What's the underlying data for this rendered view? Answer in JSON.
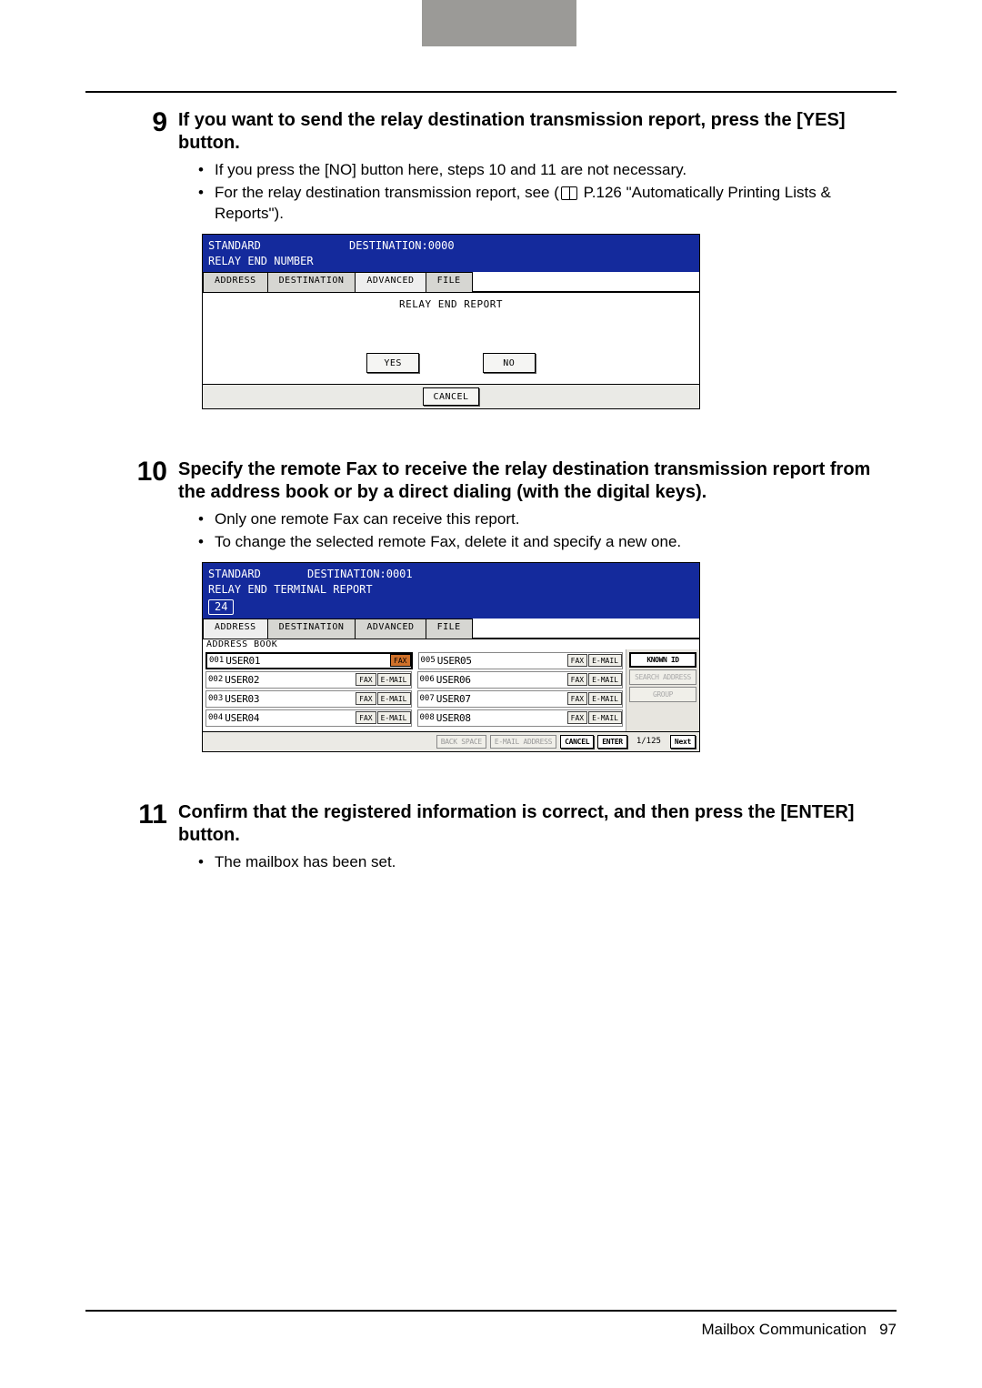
{
  "step9": {
    "num": "9",
    "title": "If you want to send the relay destination transmission report, press the [YES] button.",
    "bullets": [
      "If you press the [NO] button here, steps 10 and 11 are not necessary.",
      "For the relay destination transmission report, see (📖 P.126 \"Automatically Printing Lists & Reports\")."
    ],
    "mock": {
      "mode": "STANDARD",
      "dest": "DESTINATION:0000",
      "sub": "RELAY END NUMBER",
      "tabs": [
        "ADDRESS",
        "DESTINATION",
        "ADVANCED",
        "FILE"
      ],
      "label": "RELAY END REPORT",
      "yes": "YES",
      "no": "NO",
      "cancel": "CANCEL"
    }
  },
  "step10": {
    "num": "10",
    "title": "Specify the remote Fax to receive the relay destination transmission report from the address book or by a direct dialing (with the digital keys).",
    "bullets": [
      "Only one remote Fax can receive this report.",
      "To change the selected remote Fax, delete it and specify a new one."
    ],
    "mock": {
      "mode": "STANDARD",
      "dest": "DESTINATION:0001",
      "sub": "RELAY END TERMINAL REPORT",
      "numBox": "24",
      "tabs": [
        "ADDRESS",
        "DESTINATION",
        "ADVANCED",
        "FILE"
      ],
      "label": "ADDRESS BOOK",
      "entries": [
        {
          "id": "001",
          "name": "USER01",
          "fax": true,
          "email": false,
          "sel": true
        },
        {
          "id": "005",
          "name": "USER05",
          "fax": true,
          "email": true
        },
        {
          "id": "002",
          "name": "USER02",
          "fax": true,
          "email": true
        },
        {
          "id": "006",
          "name": "USER06",
          "fax": true,
          "email": true
        },
        {
          "id": "003",
          "name": "USER03",
          "fax": true,
          "email": true
        },
        {
          "id": "007",
          "name": "USER07",
          "fax": true,
          "email": true
        },
        {
          "id": "004",
          "name": "USER04",
          "fax": true,
          "email": true
        },
        {
          "id": "008",
          "name": "USER08",
          "fax": true,
          "email": true
        }
      ],
      "side": [
        "KNOWN ID",
        "SEARCH ADDRESS",
        "GROUP"
      ],
      "footer": {
        "backspace": "BACK SPACE",
        "emailAddr": "E-MAIL ADDRESS",
        "cancel": "CANCEL",
        "enter": "ENTER",
        "page": "1/125",
        "next": "Next"
      },
      "faxLabel": "FAX",
      "emailLabel": "E-MAIL"
    }
  },
  "step11": {
    "num": "11",
    "title": "Confirm that the registered information is correct, and then press the [ENTER] button.",
    "bullets": [
      "The mailbox has been set."
    ]
  },
  "footer": {
    "section": "Mailbox Communication",
    "page": "97"
  }
}
